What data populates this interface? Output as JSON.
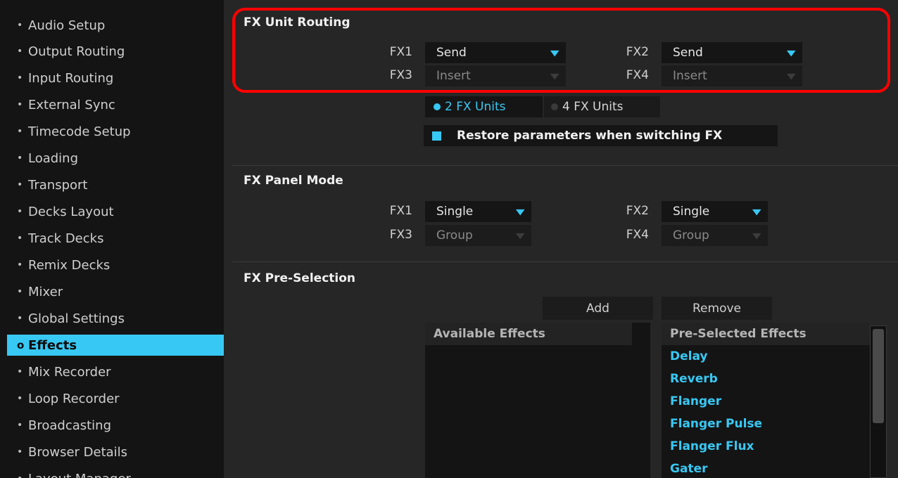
{
  "sidebar": {
    "items": [
      {
        "label": "Audio Setup"
      },
      {
        "label": "Output Routing"
      },
      {
        "label": "Input Routing"
      },
      {
        "label": "External Sync"
      },
      {
        "label": "Timecode Setup"
      },
      {
        "label": "Loading"
      },
      {
        "label": "Transport"
      },
      {
        "label": "Decks Layout"
      },
      {
        "label": "Track Decks"
      },
      {
        "label": "Remix Decks"
      },
      {
        "label": "Mixer"
      },
      {
        "label": "Global Settings"
      },
      {
        "label": "Effects"
      },
      {
        "label": "Mix Recorder"
      },
      {
        "label": "Loop Recorder"
      },
      {
        "label": "Broadcasting"
      },
      {
        "label": "Browser Details"
      },
      {
        "label": "Layout Manager"
      }
    ],
    "bullet": "•",
    "active_bullet": "o"
  },
  "fx_unit_routing": {
    "title": "FX Unit Routing",
    "fx1_label": "FX1",
    "fx1_value": "Send",
    "fx2_label": "FX2",
    "fx2_value": "Send",
    "fx3_label": "FX3",
    "fx3_value": "Insert",
    "fx4_label": "FX4",
    "fx4_value": "Insert",
    "units_2": "2 FX Units",
    "units_4": "4 FX Units",
    "restore_label": "Restore parameters when switching FX"
  },
  "fx_panel_mode": {
    "title": "FX Panel Mode",
    "fx1_label": "FX1",
    "fx1_value": "Single",
    "fx2_label": "FX2",
    "fx2_value": "Single",
    "fx3_label": "FX3",
    "fx3_value": "Group",
    "fx4_label": "FX4",
    "fx4_value": "Group"
  },
  "fx_preselection": {
    "title": "FX Pre-Selection",
    "add_label": "Add",
    "remove_label": "Remove",
    "available_header": "Available Effects",
    "preselected_header": "Pre-Selected Effects",
    "preselected_items": [
      "Delay",
      "Reverb",
      "Flanger",
      "Flanger Pulse",
      "Flanger Flux",
      "Gater"
    ]
  },
  "icons": {
    "chevron": "chevron-down-icon"
  },
  "colors": {
    "accent": "#38c8f4",
    "highlight": "#ff0000"
  }
}
